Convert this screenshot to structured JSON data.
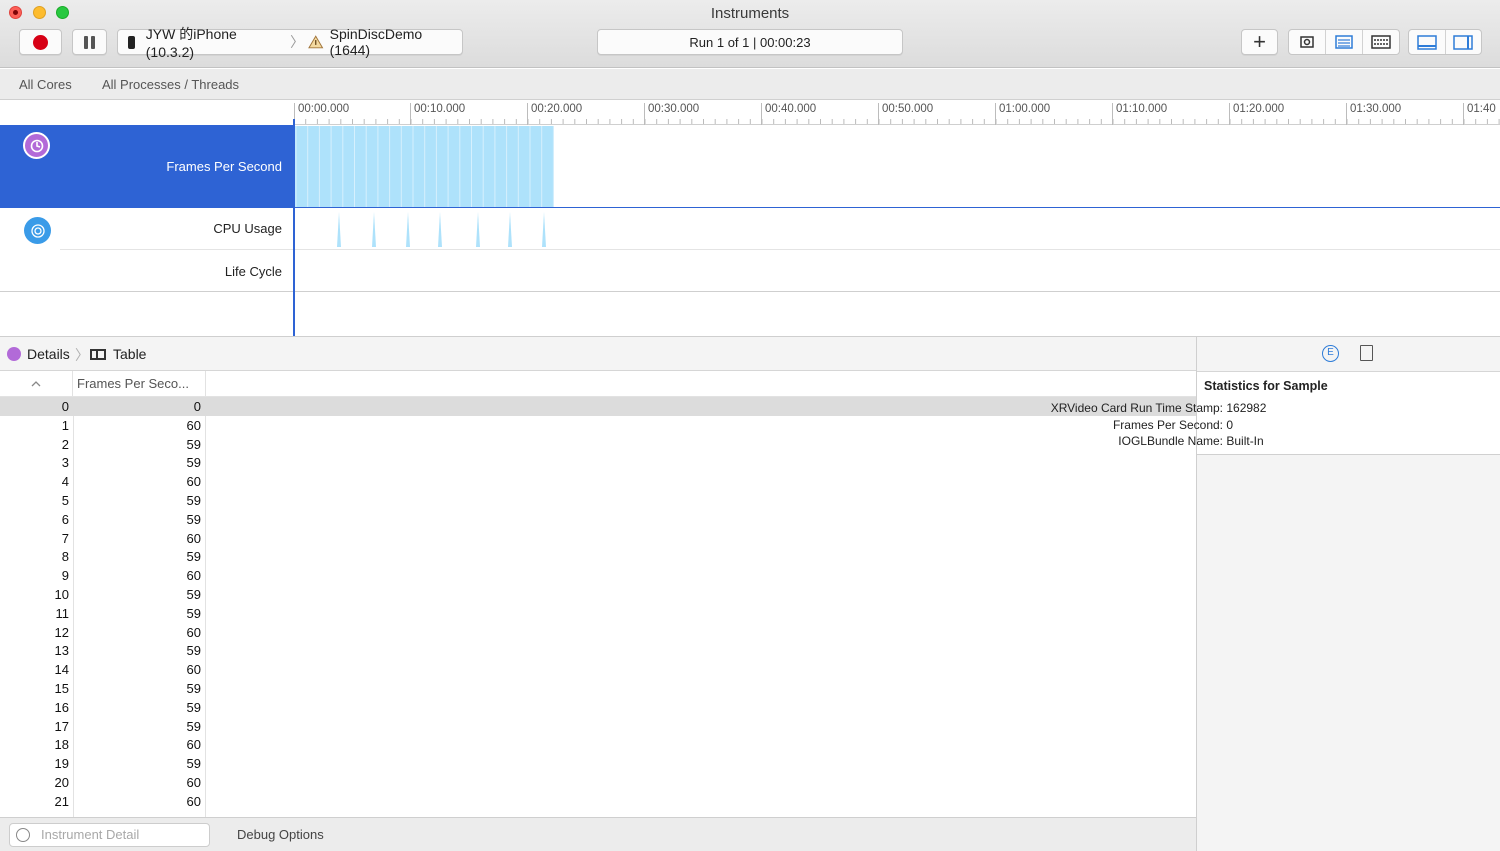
{
  "window": {
    "title": "Instruments"
  },
  "toolbar": {
    "device": "JYW 的iPhone (10.3.2)",
    "process": "SpinDiscDemo (1644)",
    "run_status": "Run 1 of 1  |  00:00:23",
    "record_color": "#d70015"
  },
  "filterbar": {
    "cores": "All Cores",
    "processes": "All Processes / Threads"
  },
  "ruler": {
    "labels": [
      "00:00.000",
      "00:10.000",
      "00:20.000",
      "00:30.000",
      "00:40.000",
      "00:50.000",
      "01:00.000",
      "01:10.000",
      "01:20.000",
      "01:30.000",
      "01:40"
    ]
  },
  "tracks": {
    "fps_label": "Frames Per Second",
    "cpu_label": "CPU Usage",
    "life_label": "Life Cycle",
    "selected_color": "#2e63d4",
    "graph_color": "#aee2fb"
  },
  "details": {
    "crumb_details": "Details",
    "crumb_table": "Table",
    "column_header": "Frames Per Seco..."
  },
  "table": {
    "rows": [
      {
        "idx": "0",
        "val": "0"
      },
      {
        "idx": "1",
        "val": "60"
      },
      {
        "idx": "2",
        "val": "59"
      },
      {
        "idx": "3",
        "val": "59"
      },
      {
        "idx": "4",
        "val": "60"
      },
      {
        "idx": "5",
        "val": "59"
      },
      {
        "idx": "6",
        "val": "59"
      },
      {
        "idx": "7",
        "val": "60"
      },
      {
        "idx": "8",
        "val": "59"
      },
      {
        "idx": "9",
        "val": "60"
      },
      {
        "idx": "10",
        "val": "59"
      },
      {
        "idx": "11",
        "val": "59"
      },
      {
        "idx": "12",
        "val": "60"
      },
      {
        "idx": "13",
        "val": "59"
      },
      {
        "idx": "14",
        "val": "60"
      },
      {
        "idx": "15",
        "val": "59"
      },
      {
        "idx": "16",
        "val": "59"
      },
      {
        "idx": "17",
        "val": "59"
      },
      {
        "idx": "18",
        "val": "60"
      },
      {
        "idx": "19",
        "val": "59"
      },
      {
        "idx": "20",
        "val": "60"
      },
      {
        "idx": "21",
        "val": "60"
      }
    ]
  },
  "bottombar": {
    "filter_placeholder": "Instrument Detail",
    "debug_options": "Debug Options"
  },
  "inspector": {
    "title": "Statistics for Sample",
    "stats": [
      {
        "key": "XRVideo Card Run Time Stamp:",
        "value": "162982"
      },
      {
        "key": "Frames Per Second:",
        "value": "0"
      },
      {
        "key": "IOGLBundle Name:",
        "value": "Built-In"
      }
    ]
  }
}
